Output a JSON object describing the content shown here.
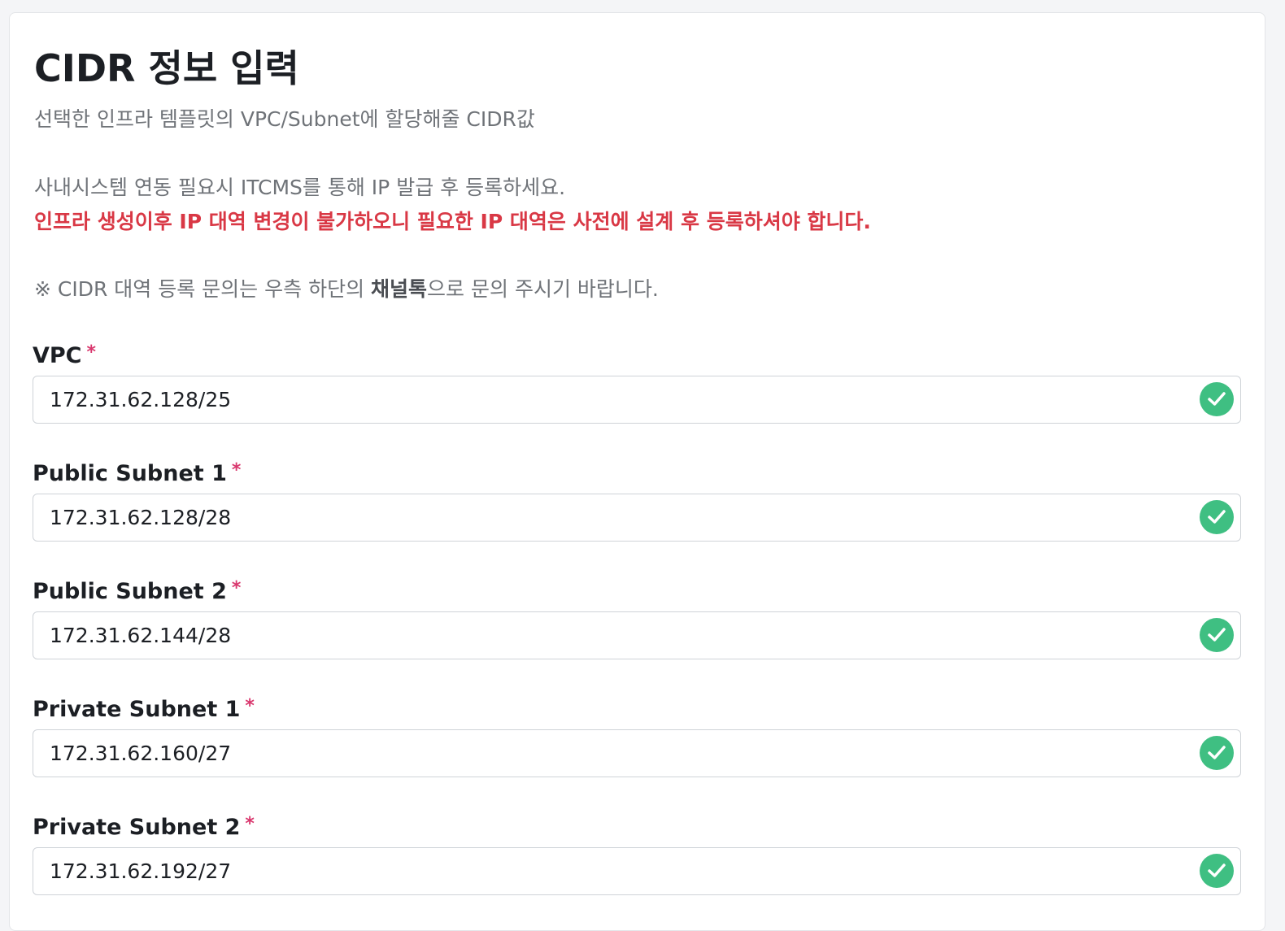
{
  "header": {
    "title": "CIDR 정보 입력",
    "subtitle": "선택한 인프라 템플릿의 VPC/Subnet에 할당해줄 CIDR값"
  },
  "notice": {
    "line1": "사내시스템 연동 필요시 ITCMS를 통해 IP 발급 후 등록하세요.",
    "warning": "인프라 생성이후 IP 대역 변경이 불가하오니 필요한 IP 대역은 사전에 설계 후 등록하셔야 합니다.",
    "contact_prefix": "※ CIDR 대역 등록 문의는 우측 하단의 ",
    "contact_channel": "채널톡",
    "contact_suffix": "으로 문의 주시기 바랍니다."
  },
  "fields": [
    {
      "label": "VPC",
      "required_mark": "*",
      "value": "172.31.62.128/25",
      "valid": true
    },
    {
      "label": "Public Subnet 1",
      "required_mark": "*",
      "value": "172.31.62.128/28",
      "valid": true
    },
    {
      "label": "Public Subnet 2",
      "required_mark": "*",
      "value": "172.31.62.144/28",
      "valid": true
    },
    {
      "label": "Private Subnet 1",
      "required_mark": "*",
      "value": "172.31.62.160/27",
      "valid": true
    },
    {
      "label": "Private Subnet 2",
      "required_mark": "*",
      "value": "172.31.62.192/27",
      "valid": true
    }
  ],
  "icons": {
    "valid": "check-circle-icon"
  },
  "colors": {
    "accent_valid": "#3fbf82",
    "warning": "#d93845",
    "required": "#d9386e"
  }
}
